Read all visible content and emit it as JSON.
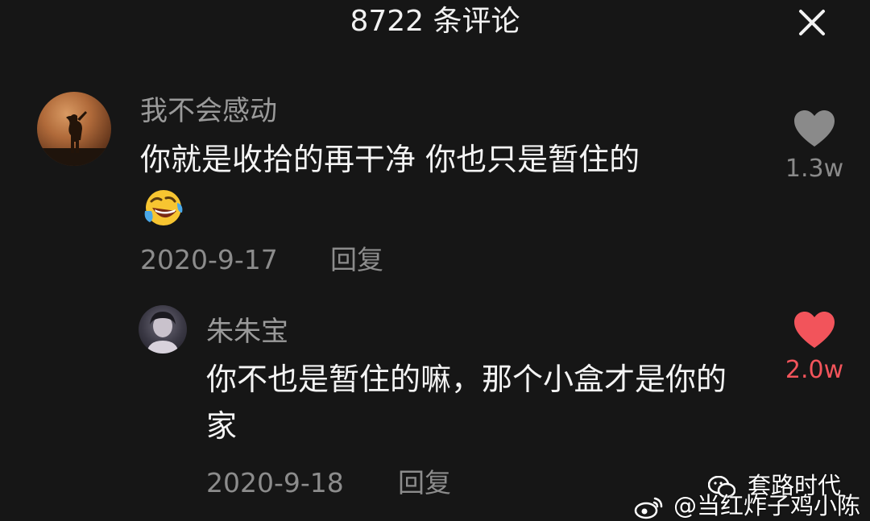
{
  "header": {
    "title": "8722 条评论"
  },
  "comments": [
    {
      "username": "我不会感动",
      "text": "你就是收拾的再干净 你也只是暂住的",
      "emoji": "laughing-tears-emoji",
      "date": "2020-9-17",
      "reply_label": "回复",
      "likes": "1.3w",
      "liked": false
    }
  ],
  "replies": [
    {
      "username": "朱朱宝",
      "text": "你不也是暂住的嘛，那个小盒才是你的家",
      "date": "2020-9-18",
      "reply_label": "回复",
      "likes": "2.0w",
      "liked": true
    }
  ],
  "watermark": {
    "line1": "套路时代",
    "line2": "@当红炸子鸡小陈"
  },
  "colors": {
    "liked": "#f2545b",
    "unliked": "#8a8a8a",
    "background": "#161616"
  },
  "icons": {
    "close": "close-icon",
    "heart_outline": "heart-icon",
    "heart_filled": "heart-filled-icon",
    "wechat": "wechat-icon",
    "weibo": "weibo-icon"
  }
}
